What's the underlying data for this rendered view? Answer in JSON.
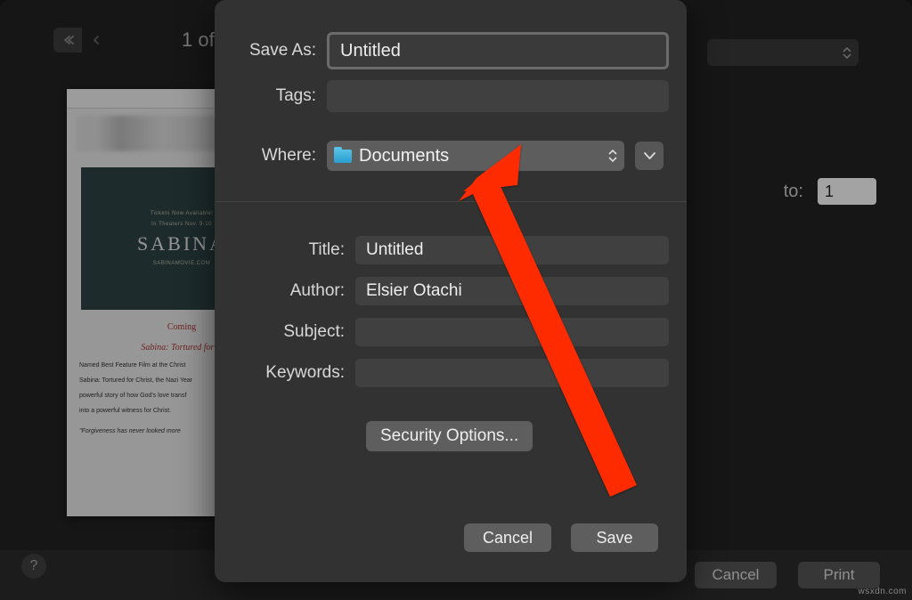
{
  "saveSheet": {
    "saveAsLabel": "Save As:",
    "saveAsValue": "Untitled",
    "tagsLabel": "Tags:",
    "tagsValue": "",
    "whereLabel": "Where:",
    "whereValue": "Documents",
    "titleLabel": "Title:",
    "titleValue": "Untitled",
    "authorLabel": "Author:",
    "authorValue": "Elsier Otachi",
    "subjectLabel": "Subject:",
    "subjectValue": "",
    "keywordsLabel": "Keywords:",
    "keywordsValue": "",
    "securityOptions": "Security Options...",
    "cancel": "Cancel",
    "save": "Save"
  },
  "background": {
    "pageCounter": "1 of",
    "toLabel": "to:",
    "toValue": "1",
    "bottomCancel": "Cancel",
    "bottomPrint": "Print",
    "helpLabel": "?"
  },
  "previewDoc": {
    "posterTagTop": "Tickets Now Available!",
    "posterTagTop2": "In Theaters Nov. 9-10",
    "posterTitle": "SABINA",
    "posterSmall": "SABINAMOVIE.COM",
    "coming": "Coming",
    "subtitle": "Sabina: Tortured for C",
    "para1": "Named Best Feature Film at the Christ",
    "para2": "Sabina: Tortured for Christ, the Nazi Year",
    "para3": "powerful story of how God's love transf",
    "para4": "into a powerful witness for Christ.",
    "quote": "\"Forgiveness has never looked more"
  },
  "watermark": "wsxdn.com"
}
